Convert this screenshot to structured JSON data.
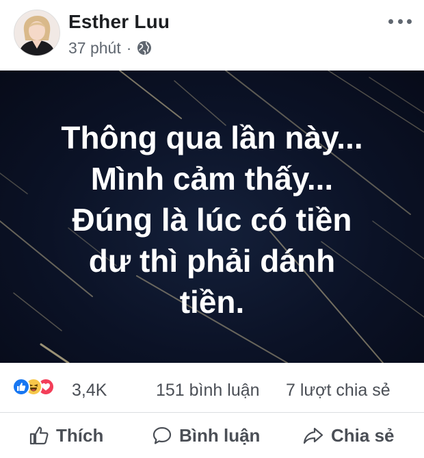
{
  "post": {
    "author": "Esther Luu",
    "time": "37 phút",
    "separator": "·",
    "visibility_icon": "globe-icon",
    "more_icon": "more-options-icon"
  },
  "image": {
    "lines": [
      "Thông qua lần này...",
      "Mình cảm thấy...",
      "Đúng là lúc có tiền",
      "dư thì phải dánh",
      "tiền."
    ]
  },
  "stats": {
    "reaction_icons": [
      "like-reaction-icon",
      "haha-reaction-icon",
      "love-reaction-icon"
    ],
    "reaction_count": "3,4K",
    "comments": "151 bình luận",
    "shares": "7 lượt chia sẻ"
  },
  "actions": {
    "like_label": "Thích",
    "comment_label": "Bình luận",
    "share_label": "Chia sẻ"
  },
  "colors": {
    "image_background": "#0b1226",
    "text_primary": "#1c1e21",
    "text_secondary": "#606770",
    "like_blue": "#1877f2",
    "love_red": "#f33e58",
    "haha_yellow": "#f7c74a"
  }
}
